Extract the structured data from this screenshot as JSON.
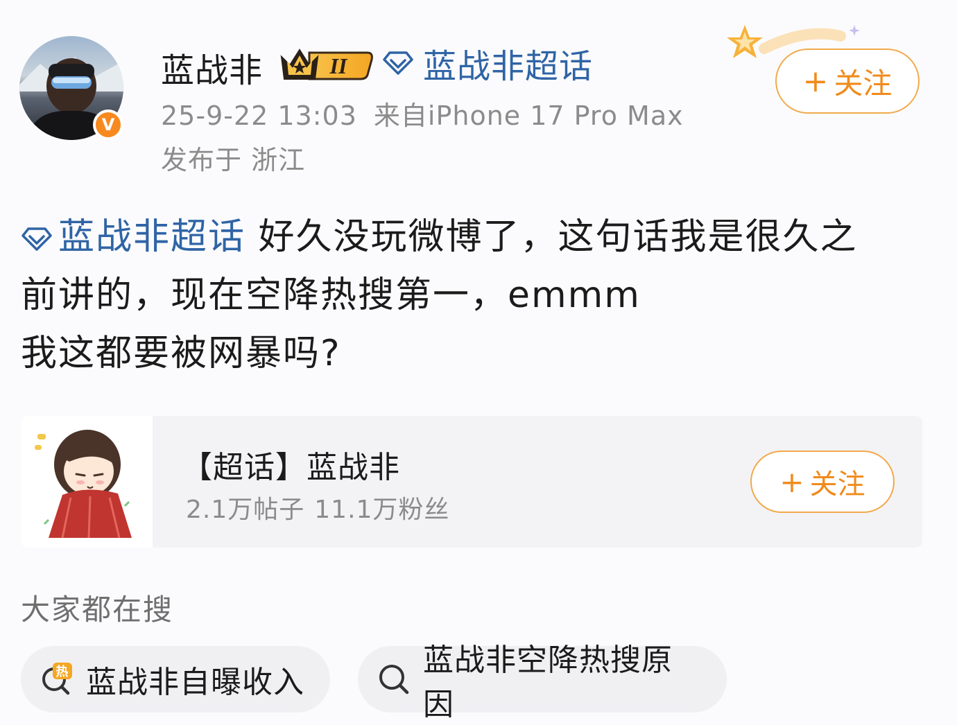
{
  "header": {
    "username": "蓝战非",
    "level_badge": "II",
    "super_topic_link": "蓝战非超话",
    "timestamp": "25-9-22 13:03",
    "source": "来自iPhone 17 Pro Max",
    "location": "发布于 浙江",
    "verified_badge": "V",
    "follow_label": "关注",
    "follow_plus": "+"
  },
  "post": {
    "topic_tag": "蓝战非超话",
    "line1": " 好久没玩微博了，这句话我是很久之",
    "line2": "前讲的，现在空降热搜第一，emmm",
    "line3": "我这都要被网暴吗?"
  },
  "topic_card": {
    "title": "【超话】蓝战非",
    "posts": "2.1万帖子",
    "fans": "11.1万粉丝",
    "follow_label": "关注",
    "follow_plus": "+"
  },
  "search": {
    "heading": "大家都在搜",
    "hot_badge": "热",
    "chips": [
      {
        "label": "蓝战非自曝收入",
        "icon": "hot-search-icon"
      },
      {
        "label": "蓝战非空降热搜原因",
        "icon": "search-icon"
      }
    ]
  },
  "colors": {
    "link_blue": "#2f64a5",
    "follow_orange": "#f08b1c",
    "verified_orange": "#f7891f",
    "meta_gray": "#8b8b8b"
  }
}
